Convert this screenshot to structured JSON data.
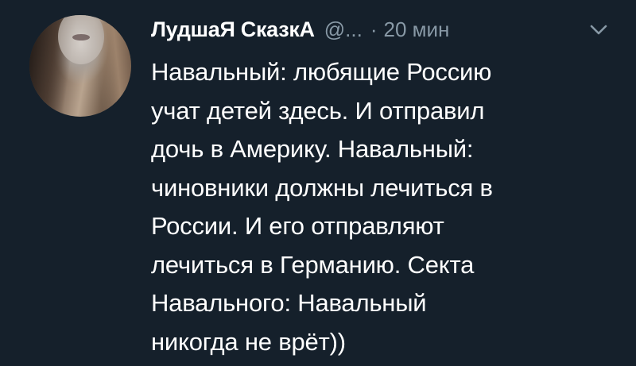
{
  "tweet": {
    "author_name": "ЛудшаЯ СказкА",
    "handle": "@...",
    "separator": "·",
    "time": "20 мин",
    "text_lines": [
      "Навальный: любящие Россию",
      "учат детей здесь. И отправил",
      "дочь в Америку. Навальный:",
      "чиновники должны лечиться в",
      "России. И его отправляют",
      "лечиться в Германию. Секта",
      "Навального: Навальный",
      "никогда не врёт))"
    ]
  },
  "colors": {
    "background": "#15202b",
    "text": "#ffffff",
    "secondary_text": "#8899a6"
  },
  "icons": {
    "menu": "chevron-down-icon"
  }
}
